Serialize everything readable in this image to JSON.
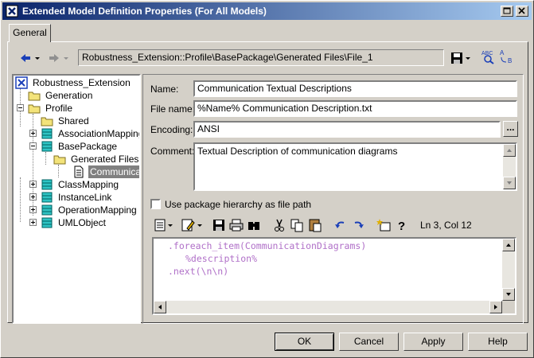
{
  "window": {
    "title": "Extended Model Definition Properties (For All Models)"
  },
  "tabs": [
    {
      "label": "General"
    }
  ],
  "toolbar": {
    "path": "Robustness_Extension::Profile\\BasePackage\\Generated Files\\File_1"
  },
  "tree": {
    "items": [
      {
        "label": "Robustness_Extension",
        "icon": "model-icon"
      },
      {
        "label": "Generation",
        "icon": "folder-icon"
      },
      {
        "label": "Profile",
        "icon": "folder-icon"
      },
      {
        "label": "Shared",
        "icon": "folder-icon"
      },
      {
        "label": "AssociationMapping",
        "icon": "class-icon"
      },
      {
        "label": "BasePackage",
        "icon": "class-icon"
      },
      {
        "label": "Generated Files",
        "icon": "folder-icon"
      },
      {
        "label": "Communicati",
        "icon": "file-icon"
      },
      {
        "label": "ClassMapping",
        "icon": "class-icon"
      },
      {
        "label": "InstanceLink",
        "icon": "class-icon"
      },
      {
        "label": "OperationMapping",
        "icon": "class-icon"
      },
      {
        "label": "UMLObject",
        "icon": "class-icon"
      }
    ]
  },
  "form": {
    "name_label": "Name:",
    "name_value": "Communication Textual Descriptions",
    "filename_label": "File name:",
    "filename_value": "%Name% Communication Description.txt",
    "encoding_label": "Encoding:",
    "encoding_value": "ANSI",
    "encoding_button": "...",
    "comment_label": "Comment:",
    "comment_value": "Textual Description of communication diagrams",
    "checkbox_label": "Use package hierarchy as file path",
    "checkbox_checked": false
  },
  "editor": {
    "position": "Ln 3, Col 12",
    "lines": [
      ".foreach_item(CommunicationDiagrams)",
      "%description%",
      ".next(\\n\\n)"
    ]
  },
  "buttons": {
    "ok": "OK",
    "cancel": "Cancel",
    "apply": "Apply",
    "help": "Help"
  },
  "colors": {
    "titlebar_start": "#0a246a",
    "titlebar_end": "#a6caf0",
    "template_purple": "#b070c8"
  }
}
